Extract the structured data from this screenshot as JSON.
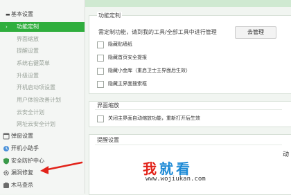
{
  "sidebar": {
    "basic_settings": "基本设置",
    "basic_items": [
      "功能定制",
      "界面缩放",
      "提醒设置",
      "系统右键菜单",
      "升级设置",
      "开机启动项设置",
      "用户体验改善计划",
      "云安全计划",
      "网址云安全计划"
    ],
    "active_index": 0,
    "sections": [
      {
        "label": "弹窗设置",
        "icon": "popup-icon"
      },
      {
        "label": "开机小助手",
        "icon": "startup-icon"
      },
      {
        "label": "安全防护中心",
        "icon": "shield-icon"
      },
      {
        "label": "漏洞修复",
        "icon": "gear-icon"
      },
      {
        "label": "木马查杀",
        "icon": "trojan-icon"
      }
    ]
  },
  "feature_custom": {
    "title": "功能定制",
    "hint": "需定制功能，请到我的工具/全部工具中进行管理",
    "manage_button": "去管理",
    "options": [
      "隐藏贴墙纸",
      "隐藏首页安全提报",
      "隐藏小金库（重启卫士主界面后生效）",
      "隐藏主界面搜索框"
    ]
  },
  "zoom": {
    "title": "界面缩放",
    "option": "关闭主界面自动缩放功能，重新打开后生效"
  },
  "remind": {
    "title": "提醒设置",
    "edge_text": "动"
  },
  "watermark": {
    "chars": [
      "我",
      "就",
      "看"
    ],
    "url": "www.wojiukan.com",
    "colors": [
      "#e2231a",
      "#1d8ad6",
      "#1d8ad6"
    ]
  },
  "colors": {
    "accent_green": "#2fae3d",
    "arrow_red": "#e2231a"
  }
}
